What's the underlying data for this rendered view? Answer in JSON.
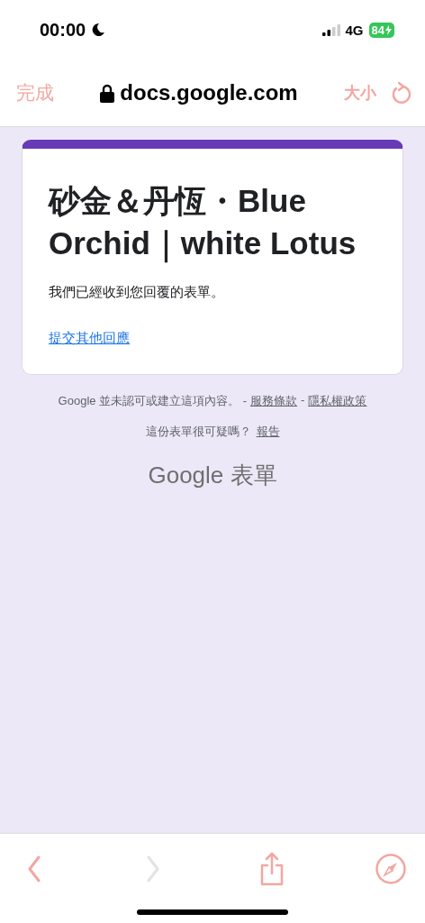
{
  "status_bar": {
    "time": "00:00",
    "network": "4G",
    "battery": "84"
  },
  "browser_bar": {
    "done": "完成",
    "url": "docs.google.com",
    "text_size": "大小"
  },
  "form_card": {
    "title": "砂金＆丹恆・Blue Orchid｜white Lotus",
    "message": "我們已經收到您回覆的表單。",
    "link": "提交其他回應"
  },
  "footer": {
    "disclaimer": "Google 並未認可或建立這項內容。 -",
    "terms": "服務條款",
    "separator": "-",
    "privacy": "隱私權政策",
    "question": "這份表單很可疑嗎？",
    "report": "報告",
    "brand": "Google 表單"
  },
  "toolbar": [
    {
      "kind": "back",
      "disabled": false
    },
    {
      "kind": "forward",
      "disabled": true
    },
    {
      "kind": "share",
      "disabled": false
    },
    {
      "kind": "compass",
      "disabled": false
    }
  ]
}
